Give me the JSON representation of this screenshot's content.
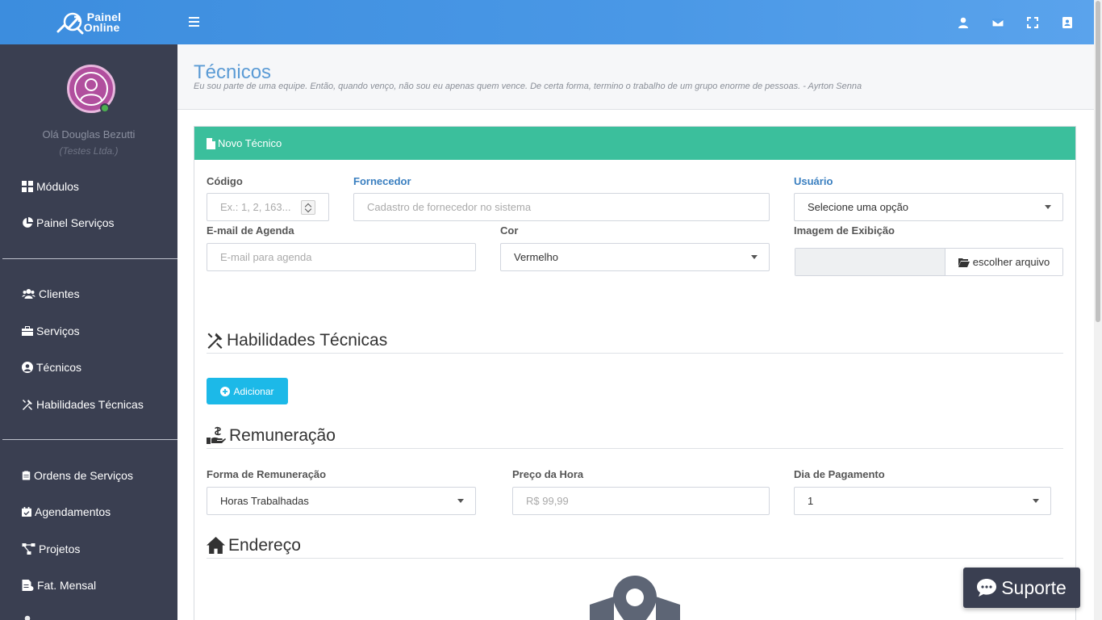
{
  "brand": {
    "line1": "Painel",
    "line2": "Online"
  },
  "topbar": {
    "icons": [
      "user-icon",
      "envelope-icon",
      "fullscreen-icon",
      "address-book-icon"
    ]
  },
  "sidebar": {
    "user_greeting": "Olá Douglas Bezutti",
    "user_company": "(Testes Ltda.)",
    "items": [
      {
        "label": "Módulos",
        "icon": "grid-icon"
      },
      {
        "label": "Painel Serviços",
        "icon": "pie-chart-icon"
      },
      {
        "label": "Clientes",
        "icon": "users-icon"
      },
      {
        "label": "Serviços",
        "icon": "briefcase-icon"
      },
      {
        "label": "Técnicos",
        "icon": "user-circle-icon"
      },
      {
        "label": "Habilidades Técnicas",
        "icon": "tools-icon"
      },
      {
        "label": "Ordens de Serviços",
        "icon": "clipboard-icon"
      },
      {
        "label": "Agendamentos",
        "icon": "calendar-check-icon"
      },
      {
        "label": "Projetos",
        "icon": "project-diagram-icon"
      },
      {
        "label": "Fat. Mensal",
        "icon": "invoice-icon"
      }
    ]
  },
  "page": {
    "title": "Técnicos",
    "quote": "Eu sou parte de uma equipe. Então, quando venço, não sou eu apenas quem vence. De certa forma, termino o trabalho de um grupo enorme de pessoas. - Ayrton Senna"
  },
  "form": {
    "card_title": "Novo Técnico",
    "codigo": {
      "label": "Código",
      "placeholder": "Ex.: 1, 2, 163..."
    },
    "fornecedor": {
      "label": "Fornecedor",
      "placeholder": "Cadastro de fornecedor no sistema"
    },
    "usuario": {
      "label": "Usuário",
      "value": "Selecione uma opção"
    },
    "email_agenda": {
      "label": "E-mail de Agenda",
      "placeholder": "E-mail para agenda"
    },
    "cor": {
      "label": "Cor",
      "value": "Vermelho"
    },
    "imagem": {
      "label": "Imagem de Exibição",
      "button": "escolher arquivo"
    },
    "habilidades_section": "Habilidades Técnicas",
    "add_button": "Adicionar",
    "remuneracao_section": "Remuneração",
    "forma_remuneracao": {
      "label": "Forma de Remuneração",
      "value": "Horas Trabalhadas"
    },
    "preco_hora": {
      "label": "Preço da Hora",
      "placeholder": "R$ 99,99"
    },
    "dia_pagamento": {
      "label": "Dia de Pagamento",
      "value": "1"
    },
    "endereco_section": "Endereço"
  },
  "support": {
    "label": "Suporte"
  },
  "colors": {
    "topbar": "#4a98e6",
    "sidebar": "#3a3f51",
    "card_header": "#3bbf9c",
    "add_button": "#1cb9e8",
    "title": "#5b9bd5"
  }
}
